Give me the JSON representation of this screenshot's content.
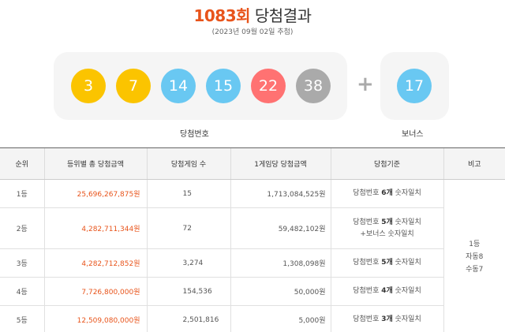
{
  "header": {
    "round": "1083회",
    "suffix": " 당첨결과",
    "date": "(2023년 09월 02일 추첨)"
  },
  "balls": [
    {
      "number": "3",
      "color": "#fbc400"
    },
    {
      "number": "7",
      "color": "#fbc400"
    },
    {
      "number": "14",
      "color": "#69c8f2"
    },
    {
      "number": "15",
      "color": "#69c8f2"
    },
    {
      "number": "22",
      "color": "#ff7272"
    },
    {
      "number": "38",
      "color": "#aaaaaa"
    }
  ],
  "plus_symbol": "+",
  "bonus_ball": {
    "number": "17",
    "color": "#69c8f2"
  },
  "labels": {
    "winning_numbers": "당첨번호",
    "bonus": "보너스"
  },
  "table": {
    "headers": [
      "순위",
      "등위별 총 당첨금액",
      "당첨게임 수",
      "1게임당 당첨금액",
      "당첨기준",
      "비고"
    ],
    "rows": [
      {
        "rank": "1등",
        "total": "25,696,267,875원",
        "games": "15",
        "per_game": "1,713,084,525원",
        "crit_a": "당첨번호 ",
        "crit_b": "6개",
        "crit_c": " 숫자일치",
        "crit_d": ""
      },
      {
        "rank": "2등",
        "total": "4,282,711,344원",
        "games": "72",
        "per_game": "59,482,102원",
        "crit_a": "당첨번호 ",
        "crit_b": "5개",
        "crit_c": " 숫자일치",
        "crit_d": "+보너스 숫자일치"
      },
      {
        "rank": "3등",
        "total": "4,282,712,852원",
        "games": "3,274",
        "per_game": "1,308,098원",
        "crit_a": "당첨번호 ",
        "crit_b": "5개",
        "crit_c": " 숫자일치",
        "crit_d": ""
      },
      {
        "rank": "4등",
        "total": "7,726,800,000원",
        "games": "154,536",
        "per_game": "50,000원",
        "crit_a": "당첨번호 ",
        "crit_b": "4개",
        "crit_c": " 숫자일치",
        "crit_d": ""
      },
      {
        "rank": "5등",
        "total": "12,509,080,000원",
        "games": "2,501,816",
        "per_game": "5,000원",
        "crit_a": "당첨번호 ",
        "crit_b": "3개",
        "crit_c": " 숫자일치",
        "crit_d": ""
      }
    ],
    "note": {
      "line1": "1등",
      "line2": "자동8",
      "line3": "수동7"
    }
  }
}
